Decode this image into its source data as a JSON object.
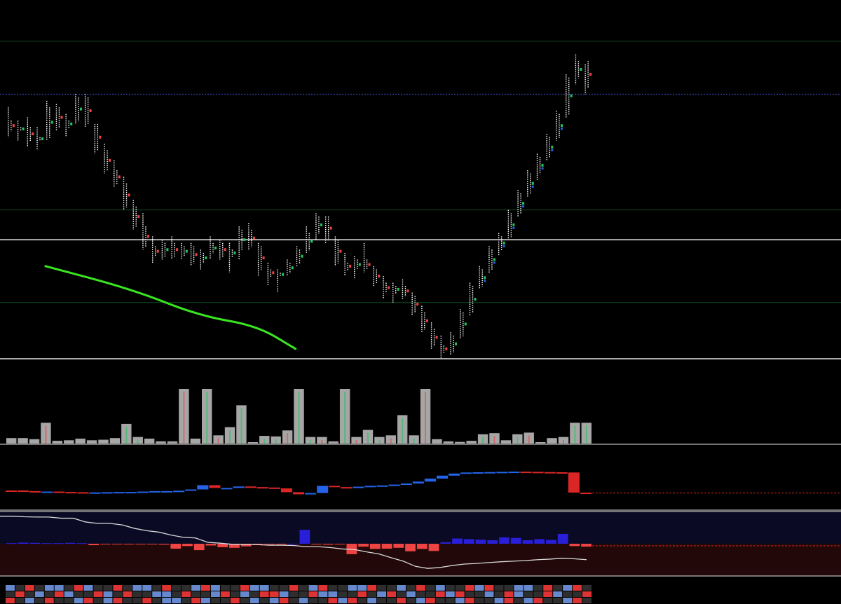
{
  "colors": {
    "background": "#000000",
    "candle": "#ffffff",
    "up_accent": "#22c55e",
    "down_accent": "#ef4444",
    "blue": "#2563eb",
    "red": "#dc2626",
    "annotation": "#39e620",
    "volume_bar": "#a6a6a6",
    "level_green": "#0f4d1f",
    "level_white": "#e6e6e6",
    "level_blue_dotted": "#4455cc",
    "osc_upper_zone": "#0a0a24",
    "osc_lower_zone": "#220808",
    "osc_line": "#d8d8d8"
  },
  "chart_data": [
    {
      "type": "candlestick",
      "title": "",
      "xlabel": "",
      "ylabel": "",
      "grid": false,
      "ylim": [
        0,
        100
      ],
      "candles": [
        {
          "o": 72,
          "h": 76,
          "l": 67,
          "c": 69
        },
        {
          "o": 69,
          "h": 72,
          "l": 66,
          "c": 70
        },
        {
          "o": 70,
          "h": 73,
          "l": 64,
          "c": 66
        },
        {
          "o": 66,
          "h": 70,
          "l": 63,
          "c": 67
        },
        {
          "o": 67,
          "h": 78,
          "l": 66,
          "c": 76
        },
        {
          "o": 76,
          "h": 77,
          "l": 69,
          "c": 70
        },
        {
          "o": 70,
          "h": 74,
          "l": 67,
          "c": 72
        },
        {
          "o": 72,
          "h": 80,
          "l": 71,
          "c": 79
        },
        {
          "o": 79,
          "h": 80,
          "l": 70,
          "c": 71
        },
        {
          "o": 71,
          "h": 71,
          "l": 62,
          "c": 63
        },
        {
          "o": 63,
          "h": 65,
          "l": 56,
          "c": 57
        },
        {
          "o": 57,
          "h": 60,
          "l": 52,
          "c": 53
        },
        {
          "o": 53,
          "h": 55,
          "l": 45,
          "c": 46
        },
        {
          "o": 46,
          "h": 48,
          "l": 39,
          "c": 40
        },
        {
          "o": 40,
          "h": 44,
          "l": 33,
          "c": 34
        },
        {
          "o": 34,
          "h": 37,
          "l": 29,
          "c": 31
        },
        {
          "o": 31,
          "h": 36,
          "l": 30,
          "c": 35
        },
        {
          "o": 35,
          "h": 37,
          "l": 30,
          "c": 31
        },
        {
          "o": 31,
          "h": 35,
          "l": 30,
          "c": 34
        },
        {
          "o": 34,
          "h": 35,
          "l": 28,
          "c": 29
        },
        {
          "o": 29,
          "h": 33,
          "l": 27,
          "c": 32
        },
        {
          "o": 32,
          "h": 37,
          "l": 30,
          "c": 35
        },
        {
          "o": 35,
          "h": 36,
          "l": 30,
          "c": 31
        },
        {
          "o": 31,
          "h": 35,
          "l": 26,
          "c": 33
        },
        {
          "o": 33,
          "h": 40,
          "l": 30,
          "c": 39
        },
        {
          "o": 39,
          "h": 41,
          "l": 33,
          "c": 34
        },
        {
          "o": 34,
          "h": 35,
          "l": 25,
          "c": 27
        },
        {
          "o": 27,
          "h": 29,
          "l": 22,
          "c": 25
        },
        {
          "o": 25,
          "h": 27,
          "l": 20,
          "c": 26
        },
        {
          "o": 26,
          "h": 30,
          "l": 25,
          "c": 29
        },
        {
          "o": 29,
          "h": 34,
          "l": 28,
          "c": 33
        },
        {
          "o": 33,
          "h": 40,
          "l": 32,
          "c": 38
        },
        {
          "o": 38,
          "h": 44,
          "l": 36,
          "c": 43
        },
        {
          "o": 43,
          "h": 43,
          "l": 35,
          "c": 36
        },
        {
          "o": 36,
          "h": 37,
          "l": 28,
          "c": 29
        },
        {
          "o": 29,
          "h": 32,
          "l": 25,
          "c": 27
        },
        {
          "o": 27,
          "h": 31,
          "l": 24,
          "c": 30
        },
        {
          "o": 30,
          "h": 35,
          "l": 26,
          "c": 27
        },
        {
          "o": 27,
          "h": 28,
          "l": 22,
          "c": 23
        },
        {
          "o": 23,
          "h": 25,
          "l": 18,
          "c": 20
        },
        {
          "o": 20,
          "h": 23,
          "l": 17,
          "c": 22
        },
        {
          "o": 22,
          "h": 24,
          "l": 18,
          "c": 19
        },
        {
          "o": 19,
          "h": 20,
          "l": 13,
          "c": 14
        },
        {
          "o": 14,
          "h": 16,
          "l": 8,
          "c": 9
        },
        {
          "o": 9,
          "h": 11,
          "l": 3,
          "c": 4
        },
        {
          "o": 4,
          "h": 7,
          "l": 0,
          "c": 2
        },
        {
          "o": 2,
          "h": 8,
          "l": 1,
          "c": 7
        },
        {
          "o": 7,
          "h": 15,
          "l": 6,
          "c": 14
        },
        {
          "o": 14,
          "h": 23,
          "l": 13,
          "c": 22
        },
        {
          "o": 22,
          "h": 28,
          "l": 21,
          "c": 27
        },
        {
          "o": 27,
          "h": 34,
          "l": 26,
          "c": 33
        },
        {
          "o": 33,
          "h": 38,
          "l": 31,
          "c": 37
        },
        {
          "o": 37,
          "h": 45,
          "l": 36,
          "c": 44
        },
        {
          "o": 44,
          "h": 51,
          "l": 43,
          "c": 50
        },
        {
          "o": 50,
          "h": 57,
          "l": 49,
          "c": 56
        },
        {
          "o": 56,
          "h": 62,
          "l": 54,
          "c": 61
        },
        {
          "o": 61,
          "h": 68,
          "l": 60,
          "c": 67
        },
        {
          "o": 67,
          "h": 75,
          "l": 66,
          "c": 74
        },
        {
          "o": 74,
          "h": 86,
          "l": 73,
          "c": 85
        },
        {
          "o": 85,
          "h": 92,
          "l": 83,
          "c": 90
        },
        {
          "o": 90,
          "h": 89,
          "l": 80,
          "c": 82
        }
      ],
      "levels": [
        {
          "value": 96,
          "style": "green"
        },
        {
          "value": 80,
          "style": "blue-dotted"
        },
        {
          "value": 45,
          "style": "green"
        },
        {
          "value": 36,
          "style": "white"
        },
        {
          "value": 17,
          "style": "green"
        },
        {
          "value": 0,
          "style": "white"
        }
      ],
      "annotation": {
        "kind": "freehand-curve",
        "color": "annotation",
        "description_points": [
          [
            0,
            28
          ],
          [
            9,
            21
          ],
          [
            16,
            13
          ],
          [
            22,
            10
          ],
          [
            26,
            3
          ]
        ]
      }
    },
    {
      "type": "bar",
      "title": "",
      "ylim": [
        0,
        100
      ],
      "values": [
        10,
        10,
        8,
        38,
        5,
        6,
        9,
        6,
        7,
        10,
        36,
        12,
        9,
        4,
        4,
        100,
        9,
        100,
        15,
        30,
        70,
        0,
        14,
        13,
        24,
        100,
        12,
        12,
        4,
        100,
        12,
        25,
        12,
        15,
        52,
        15,
        100,
        8,
        4,
        3,
        5,
        17,
        19,
        6,
        17,
        20,
        2,
        10,
        12,
        38,
        38
      ]
    },
    {
      "type": "bar",
      "title": "",
      "series": [
        {
          "values": [
            0,
            -3,
            -5,
            -5,
            -7,
            -8,
            -9,
            -9,
            -8,
            -7,
            -7,
            -5,
            -3,
            -3,
            -1,
            5,
            25,
            12,
            12,
            19,
            16,
            14,
            10,
            -8,
            -18,
            -12,
            22,
            16,
            14,
            18,
            22,
            24,
            28,
            33,
            42,
            56,
            70,
            80,
            85,
            86,
            87,
            88,
            89,
            88,
            87,
            86,
            85,
            -10,
            -12
          ]
        }
      ]
    },
    {
      "type": "area",
      "title": "",
      "ylim": [
        -100,
        100
      ],
      "series": [
        {
          "values": [
            2,
            4,
            3,
            2,
            2,
            3,
            2,
            -5,
            -1,
            -2,
            -2,
            -1,
            -1,
            -3,
            -17,
            -8,
            -22,
            -6,
            -12,
            -14,
            -9,
            -3,
            -1,
            -1,
            0,
            48,
            -2,
            -3,
            -1,
            -36,
            -10,
            -18,
            -17,
            -14,
            -26,
            -18,
            -25,
            5,
            18,
            16,
            14,
            12,
            22,
            20,
            12,
            16,
            13,
            34,
            -8,
            -10
          ]
        },
        {
          "values": [
            95,
            95,
            93,
            92,
            92,
            88,
            88,
            75,
            70,
            70,
            65,
            53,
            45,
            40,
            30,
            22,
            20,
            5,
            2,
            -2,
            -3,
            -3,
            -5,
            -5,
            -6,
            -10,
            -10,
            -13,
            -18,
            -20,
            -28,
            -35,
            -48,
            -60,
            -78,
            -85,
            -82,
            -75,
            -70,
            -68,
            -65,
            -62,
            -60,
            -58,
            -55,
            -53,
            -50,
            -52,
            -55
          ]
        }
      ]
    },
    {
      "type": "heatmap",
      "title": "",
      "rows": 3,
      "cells": [
        [
          1,
          0,
          2,
          0,
          1,
          1,
          0,
          2,
          1,
          0,
          0,
          2,
          0,
          1,
          1,
          0,
          2,
          0,
          0,
          1,
          2,
          1,
          0,
          0,
          2,
          1,
          1,
          0,
          0,
          2,
          0,
          1,
          2,
          0,
          0,
          1,
          1,
          2,
          0,
          0,
          1,
          0,
          2,
          0,
          1,
          0,
          0,
          2,
          1,
          2,
          0,
          0,
          1,
          1,
          0,
          2,
          0,
          1,
          2,
          0
        ],
        [
          0,
          2,
          0,
          1,
          0,
          2,
          1,
          0,
          0,
          2,
          1,
          0,
          2,
          0,
          0,
          1,
          1,
          0,
          2,
          0,
          0,
          1,
          2,
          0,
          1,
          0,
          2,
          2,
          1,
          0,
          0,
          2,
          1,
          1,
          0,
          0,
          2,
          0,
          1,
          2,
          0,
          1,
          0,
          0,
          2,
          1,
          2,
          0,
          0,
          1,
          0,
          2,
          1,
          0,
          0,
          2,
          1,
          0,
          0,
          2
        ],
        [
          2,
          0,
          1,
          0,
          2,
          0,
          0,
          1,
          2,
          0,
          1,
          2,
          0,
          0,
          2,
          0,
          1,
          1,
          0,
          2,
          1,
          0,
          0,
          2,
          0,
          1,
          0,
          1,
          2,
          0,
          1,
          0,
          0,
          2,
          1,
          2,
          0,
          1,
          0,
          0,
          2,
          0,
          1,
          2,
          0,
          0,
          1,
          2,
          0,
          0,
          1,
          2,
          0,
          1,
          2,
          0,
          0,
          1,
          2,
          0
        ]
      ]
    }
  ]
}
